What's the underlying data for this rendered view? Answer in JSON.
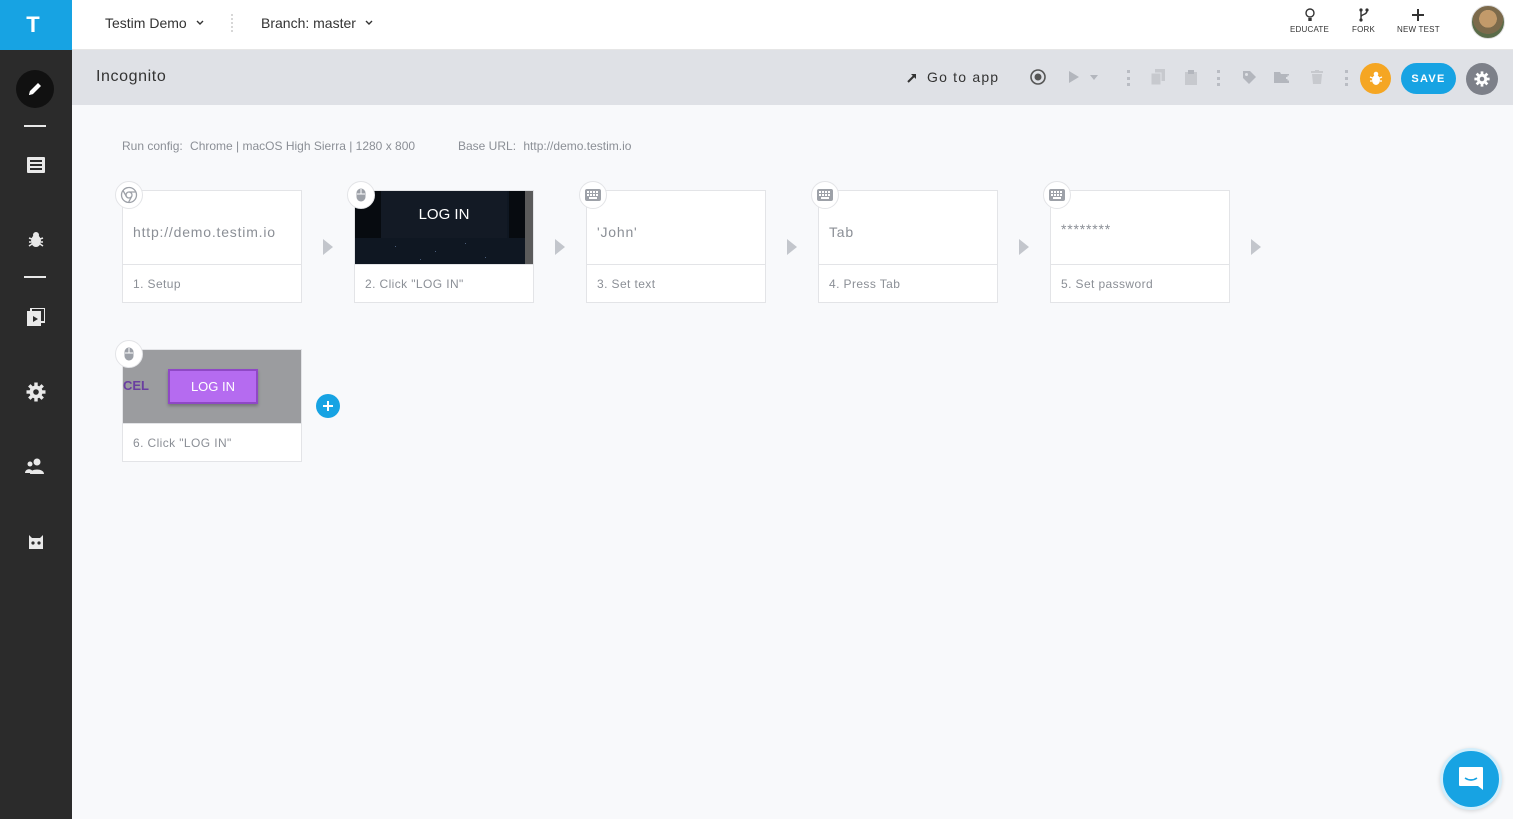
{
  "sidebar": {
    "logo": "T",
    "items": [
      {
        "icon": "pencil-icon"
      },
      {
        "icon": "list-icon"
      },
      {
        "icon": "bug-icon"
      },
      {
        "icon": "suites-icon"
      },
      {
        "icon": "settings-gear-icon"
      },
      {
        "icon": "team-icon"
      },
      {
        "icon": "mask-icon"
      }
    ]
  },
  "topbar": {
    "project": "Testim Demo",
    "branch": "Branch: master",
    "educate": "EDUCATE",
    "fork": "FORK",
    "new_test": "NEW TEST"
  },
  "toolbar": {
    "test_name": "Incognito",
    "go_to_app": "Go to app",
    "save": "SAVE",
    "accent": "#17a3e3",
    "bug_color": "#f5a623"
  },
  "run_info": {
    "run_config_label": "Run config:",
    "run_config_value": "Chrome | macOS High Sierra | 1280 x 800",
    "base_url_label": "Base URL:",
    "base_url_value": "http://demo.testim.io"
  },
  "steps": [
    {
      "icon": "chrome-icon",
      "preview": "http://demo.testim.io",
      "label": "1. Setup"
    },
    {
      "icon": "mouse-icon",
      "preview": "LOG IN",
      "label": "2. Click \"LOG IN\""
    },
    {
      "icon": "keyboard-icon",
      "preview": "'John'",
      "label": "3. Set text"
    },
    {
      "icon": "keyboard-icon",
      "preview": "Tab",
      "label": "4. Press Tab"
    },
    {
      "icon": "keyboard-icon",
      "preview": "********",
      "label": "5. Set password"
    },
    {
      "icon": "mouse-icon",
      "preview": "LOG IN",
      "preview_side": "CEL",
      "label": "6. Click \"LOG IN\""
    }
  ]
}
